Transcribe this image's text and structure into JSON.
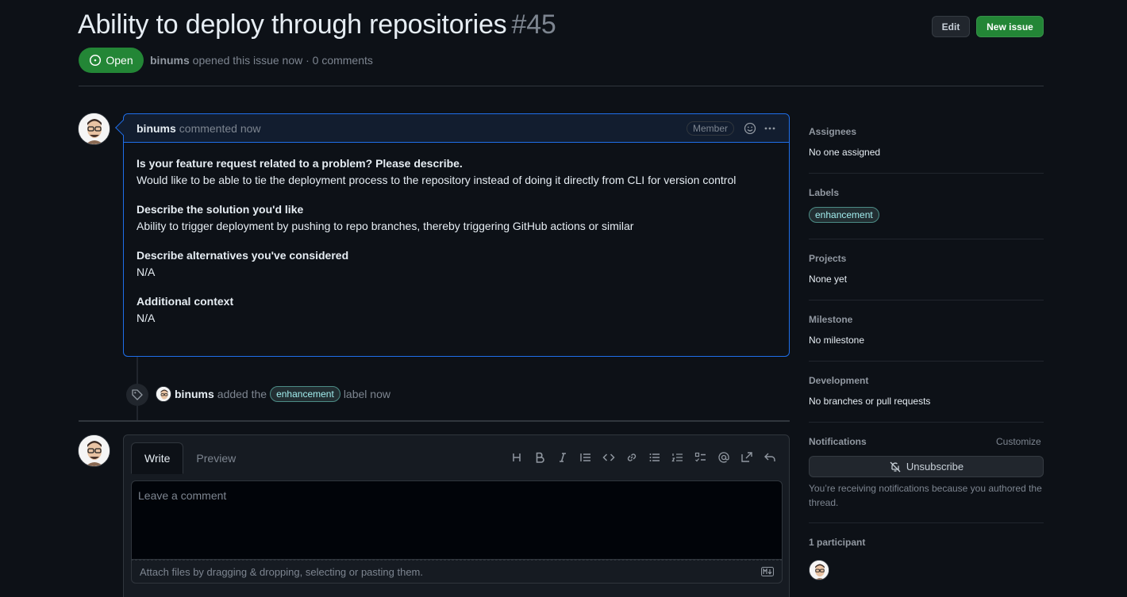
{
  "issue": {
    "title": "Ability to deploy through repositories",
    "number": "#45",
    "state": "Open",
    "author": "binums",
    "meta_text": "opened this issue now · 0 comments"
  },
  "header_buttons": {
    "edit": "Edit",
    "new_issue": "New issue"
  },
  "comment": {
    "author": "binums",
    "time_text": "commented now",
    "role_badge": "Member",
    "sections": [
      {
        "heading": "Is your feature request related to a problem? Please describe.",
        "text": "Would like to be able to tie the deployment process to the repository instead of doing it directly from CLI for version control"
      },
      {
        "heading": "Describe the solution you'd like",
        "text": "Ability to trigger deployment by pushing to repo branches, thereby triggering GitHub actions or similar"
      },
      {
        "heading": "Describe alternatives you've considered",
        "text": "N/A"
      },
      {
        "heading": "Additional context",
        "text": "N/A"
      }
    ]
  },
  "event": {
    "actor": "binums",
    "pre_text": "added the",
    "label": "enhancement",
    "post_text": "label now"
  },
  "editor": {
    "tab_write": "Write",
    "tab_preview": "Preview",
    "placeholder": "Leave a comment",
    "attach_text": "Attach files by dragging & dropping, selecting or pasting them."
  },
  "sidebar": {
    "assignees": {
      "heading": "Assignees",
      "value": "No one assigned"
    },
    "labels": {
      "heading": "Labels",
      "value": "enhancement"
    },
    "projects": {
      "heading": "Projects",
      "value": "None yet"
    },
    "milestone": {
      "heading": "Milestone",
      "value": "No milestone"
    },
    "development": {
      "heading": "Development",
      "value": "No branches or pull requests"
    },
    "notifications": {
      "heading": "Notifications",
      "customize": "Customize",
      "button": "Unsubscribe",
      "note": "You’re receiving notifications because you authored the thread."
    },
    "participants": {
      "heading": "1 participant"
    }
  },
  "colors": {
    "accent_green": "#238636",
    "accent_blue": "#1f6feb",
    "bg": "#0d1117"
  }
}
